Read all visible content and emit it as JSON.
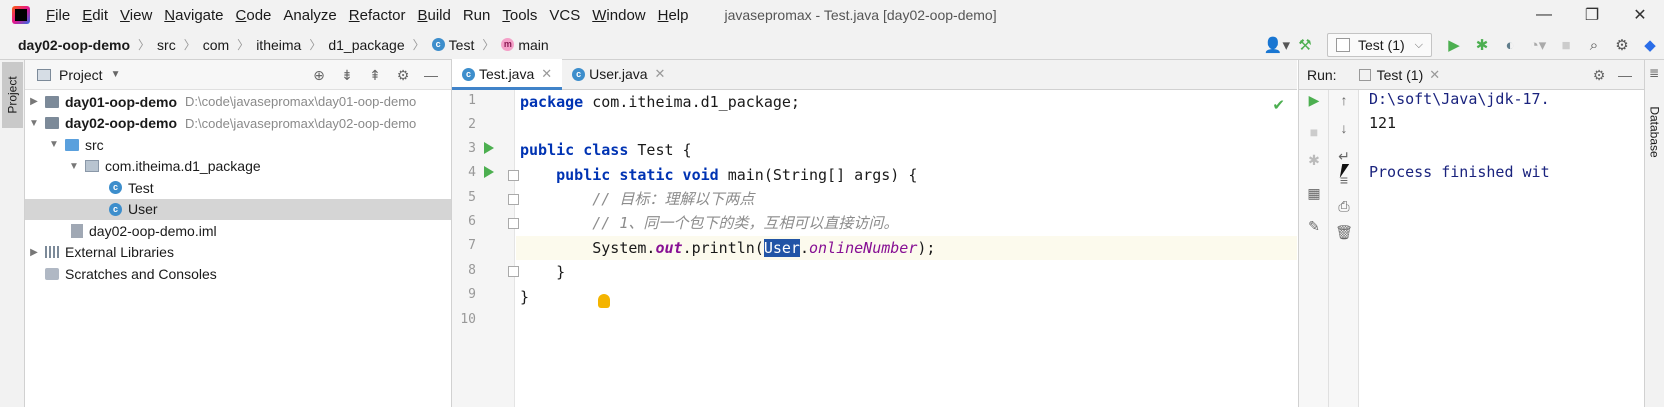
{
  "menubar": {
    "items": [
      {
        "label": "File",
        "u": "F",
        "rest": "ile"
      },
      {
        "label": "Edit",
        "u": "E",
        "rest": "dit"
      },
      {
        "label": "View",
        "u": "V",
        "rest": "iew"
      },
      {
        "label": "Navigate",
        "u": "N",
        "rest": "avigate"
      },
      {
        "label": "Code",
        "u": "C",
        "rest": "ode"
      },
      {
        "label": "Analyze",
        "u": "",
        "rest": "Analyze"
      },
      {
        "label": "Refactor",
        "u": "R",
        "rest": "efactor"
      },
      {
        "label": "Build",
        "u": "B",
        "rest": "uild"
      },
      {
        "label": "Run",
        "u": "",
        "rest": "Run"
      },
      {
        "label": "Tools",
        "u": "T",
        "rest": "ools"
      },
      {
        "label": "VCS",
        "u": "",
        "rest": "VCS"
      },
      {
        "label": "Window",
        "u": "W",
        "rest": "indow"
      },
      {
        "label": "Help",
        "u": "H",
        "rest": "elp"
      }
    ],
    "window_title": "javasepromax - Test.java [day02-oop-demo]"
  },
  "window_controls": {
    "minimize": "—",
    "restore": "❐",
    "close": "✕"
  },
  "breadcrumb": {
    "project": "day02-oop-demo",
    "items": [
      "src",
      "com",
      "itheima",
      "d1_package"
    ],
    "class_name": "Test",
    "class_icon": "c",
    "method_name": "main",
    "method_icon": "m"
  },
  "toolbar": {
    "run_config": "Test (1)",
    "icons": [
      "user-icon",
      "hammer-icon",
      "run-icon",
      "debug-icon",
      "coverage-icon",
      "profile-icon",
      "stop-icon",
      "search-icon",
      "settings-icon",
      "plugin-icon"
    ]
  },
  "left_strip": {
    "tab_label": "Project"
  },
  "project_panel": {
    "title": "Project",
    "tree": [
      {
        "label": "day01-oop-demo",
        "hint": "D:\\code\\javasepromax\\day01-oop-demo"
      },
      {
        "label": "day02-oop-demo",
        "hint": "D:\\code\\javasepromax\\day02-oop-demo"
      },
      {
        "label": "src"
      },
      {
        "label": "com.itheima.d1_package"
      },
      {
        "label": "Test"
      },
      {
        "label": "User"
      },
      {
        "label": "day02-oop-demo.iml"
      },
      {
        "label": "External Libraries"
      },
      {
        "label": "Scratches and Consoles"
      }
    ]
  },
  "editor": {
    "tabs": [
      {
        "label": "Test.java",
        "close": "✕"
      },
      {
        "label": "User.java",
        "close": "✕"
      }
    ],
    "line_numbers": [
      "1",
      "2",
      "3",
      "4",
      "5",
      "6",
      "7",
      "8",
      "9",
      "10"
    ],
    "lines": {
      "l1_kw": "package",
      "l1_rest": " com.itheima.d1_package;",
      "l3_kw": "public class",
      "l3_rest": " Test {",
      "l4_indent": "    ",
      "l4_kw": "public static void",
      "l4_rest": " main(String[] args) {",
      "l5": "        // 目标：理解以下两点",
      "l6": "        // 1、同一个包下的类，互相可以直接访问。",
      "l7_pre": "        System.",
      "l7_out": "out",
      "l7_mid": ".println(",
      "l7_sel": "User",
      "l7_dot": ".",
      "l7_field": "onlineNumber",
      "l7_end": ");",
      "l8": "    }",
      "l9": "}"
    }
  },
  "run_panel": {
    "label": "Run:",
    "tab_label": "Test (1)",
    "tab_close": "✕",
    "console": {
      "path": "D:\\soft\\Java\\jdk-17.",
      "output": "121",
      "finished": "Process finished wit"
    }
  },
  "right_strip": {
    "tab_label": "Database"
  }
}
